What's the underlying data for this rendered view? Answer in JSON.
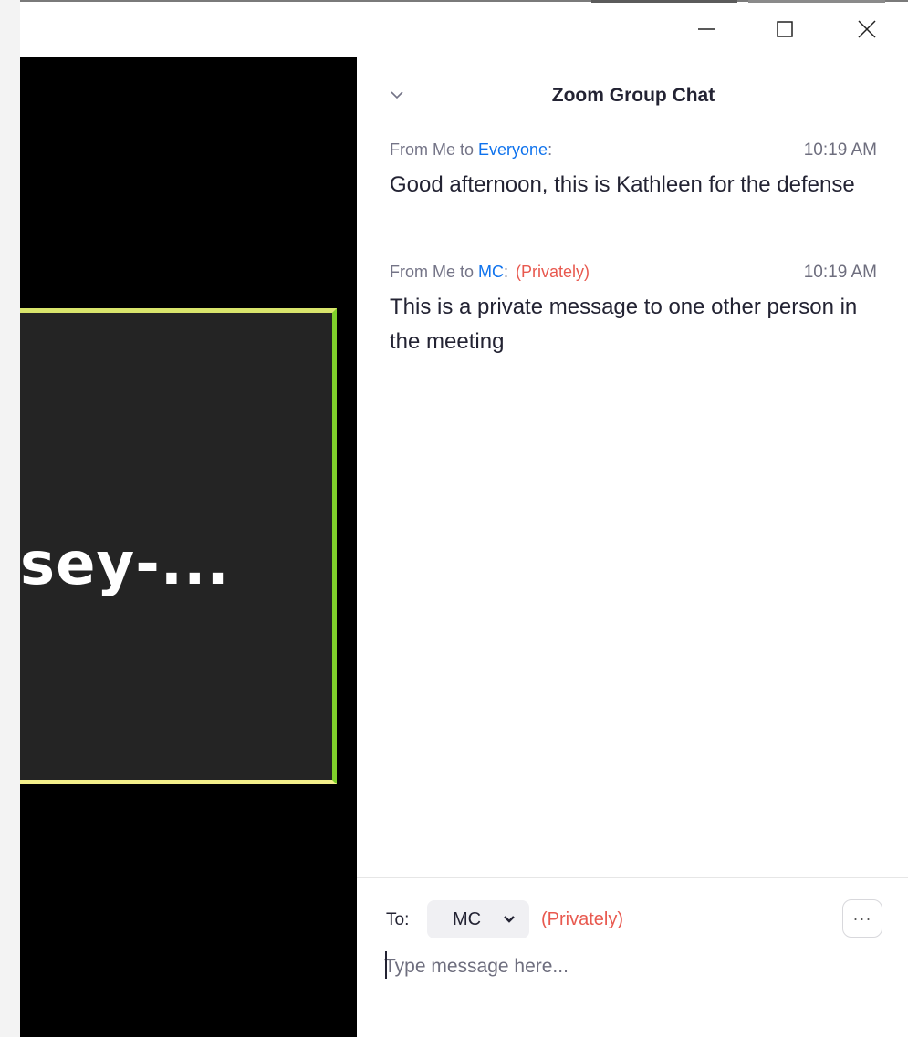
{
  "window": {
    "minimize_icon": "minimize-icon",
    "maximize_icon": "maximize-icon",
    "close_icon": "close-icon"
  },
  "video": {
    "participant_name": "sey-..."
  },
  "chat": {
    "title": "Zoom Group Chat",
    "messages": [
      {
        "from_prefix": "From Me to ",
        "to": "Everyone",
        "to_suffix": ":",
        "privately": "",
        "time": "10:19 AM",
        "text": "Good afternoon, this is Kathleen for the defense"
      },
      {
        "from_prefix": "From Me to ",
        "to": "MC",
        "to_suffix": ":",
        "privately": "(Privately)",
        "time": "10:19 AM",
        "text": "This is a private message to one other person in the meeting"
      }
    ],
    "composer": {
      "to_label": "To:",
      "recipient": "MC",
      "privately": "(Privately)",
      "more_label": "···",
      "placeholder": "Type message here..."
    }
  },
  "colors": {
    "link_blue": "#0e72ed",
    "private_red": "#e8594f",
    "speaker_border_yellow": "#d9e56c",
    "speaker_border_green": "#7fd02b"
  }
}
